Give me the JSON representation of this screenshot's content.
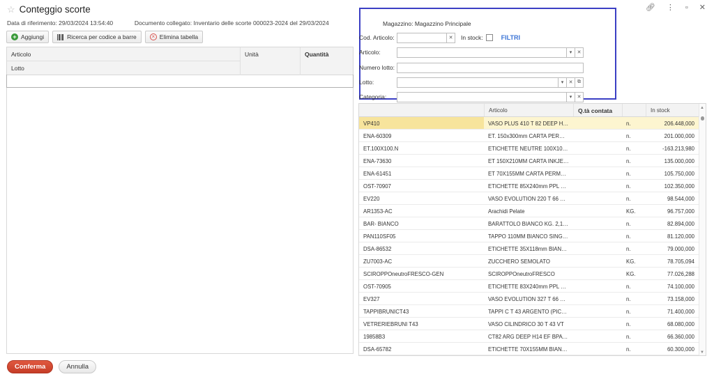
{
  "header": {
    "title": "Conteggio scorte",
    "star_icon": "star-icon",
    "date_label": "Data di riferimento: 29/03/2024 13:54:40",
    "linked_doc_label": "Documento collegato: Inventario delle scorte 000023-2024 del 29/03/2024"
  },
  "window_icons": [
    "link-icon",
    "more-vertical-icon",
    "restore-icon",
    "close-icon"
  ],
  "toolbar": {
    "add_label": "Aggiungi",
    "barcode_label": "Ricerca per codice a barre",
    "clear_label": "Elimina tabella"
  },
  "left_grid": {
    "col_articolo": "Articolo",
    "col_lotto": "Lotto",
    "col_unita": "Unità",
    "col_quantita": "Quantità"
  },
  "filters": {
    "magazzino": "Magazzino: Magazzino Principale",
    "cod_articolo_label": "Cod. Articolo:",
    "in_stock_label": "In stock:",
    "filtri_label": "FILTRI",
    "articolo_label": "Articolo:",
    "numero_lotto_label": "Numero lotto:",
    "lotto_label": "Lotto:",
    "categoria_label": "Categoria:"
  },
  "stock_grid": {
    "headers": [
      "",
      "Articolo",
      "Q.tà contata",
      "",
      "In stock"
    ],
    "rows": [
      [
        "VP410",
        "VASO PLUS 410 T 82 DEEP H 1...",
        "",
        "n.",
        "206.448,000"
      ],
      [
        "ENA-60309",
        "ET. 150x300mm CARTA PERMA...",
        "",
        "n.",
        "201.000,000"
      ],
      [
        "ET.100X100.N",
        "ETICHETTE NEUTRE 100X100 I...",
        "",
        "n.",
        "-163.213,980"
      ],
      [
        "ENA-73630",
        "ET 150X210MM CARTA INKJET ...",
        "",
        "n.",
        "135.000,000"
      ],
      [
        "ENA-61451",
        "ET 70X155MM CARTA PERMAN...",
        "",
        "n.",
        "105.750,000"
      ],
      [
        "OST-70907",
        "ETICHETTE 85X240mm PPL BIA...",
        "",
        "n.",
        "102.350,000"
      ],
      [
        "EV220",
        "VASO EVOLUTION 220 T 66 DE...",
        "",
        "n.",
        "98.544,000"
      ],
      [
        "AR1353-AC",
        "Arachidi Pelate",
        "",
        "KG.",
        "96.757,000"
      ],
      [
        "BAR- BIANCO",
        "BARATTOLO BIANCO KG. 2,1 G...",
        "",
        "n.",
        "82.894,000"
      ],
      [
        "PAN110SF05",
        "TAPPO 110MM BIANCO SINGLE...",
        "",
        "n.",
        "81.120,000"
      ],
      [
        "DSA-86532",
        "ETICHETTE 35X118mm BIANCO...",
        "",
        "n.",
        "79.000,000"
      ],
      [
        "ZU7003-AC",
        "ZUCCHERO SEMOLATO",
        "",
        "KG.",
        "78.705,094"
      ],
      [
        "SCIROPPOneutroFRESCO-GEN",
        "SCIROPPOneutroFRESCO",
        "",
        "KG.",
        "77.026,288"
      ],
      [
        "OST-70905",
        "ETICHETTE 83X240mm PPL BIA...",
        "",
        "n.",
        "74.100,000"
      ],
      [
        "EV327",
        "VASO EVOLUTION 327 T 66 DE...",
        "",
        "n.",
        "73.158,000"
      ],
      [
        "TAPPIBRUNICT43",
        "TAPPI C T 43 ARGENTO (PICC...",
        "",
        "n.",
        "71.400,000"
      ],
      [
        "VETRERIEBRUNI T43",
        "VASO CILINDRICO 30 T 43 VT",
        "",
        "n.",
        "68.080,000"
      ],
      [
        "19858B3",
        "CT82 ARG DEEP H14 EF BPA 3...",
        "",
        "n.",
        "66.360,000"
      ],
      [
        "DSA-65782",
        "ETICHETTE 70X155MM BIANCO...",
        "",
        "n.",
        "60.300,000"
      ]
    ],
    "selected_row": 0
  },
  "footer": {
    "confirm_label": "Conferma",
    "cancel_label": "Annulla"
  },
  "colors": {
    "accent_red": "#d04a32",
    "highlight_border": "#3b3fc4",
    "selected_row": "#f7e49c",
    "filtri_link": "#3b74d6"
  }
}
